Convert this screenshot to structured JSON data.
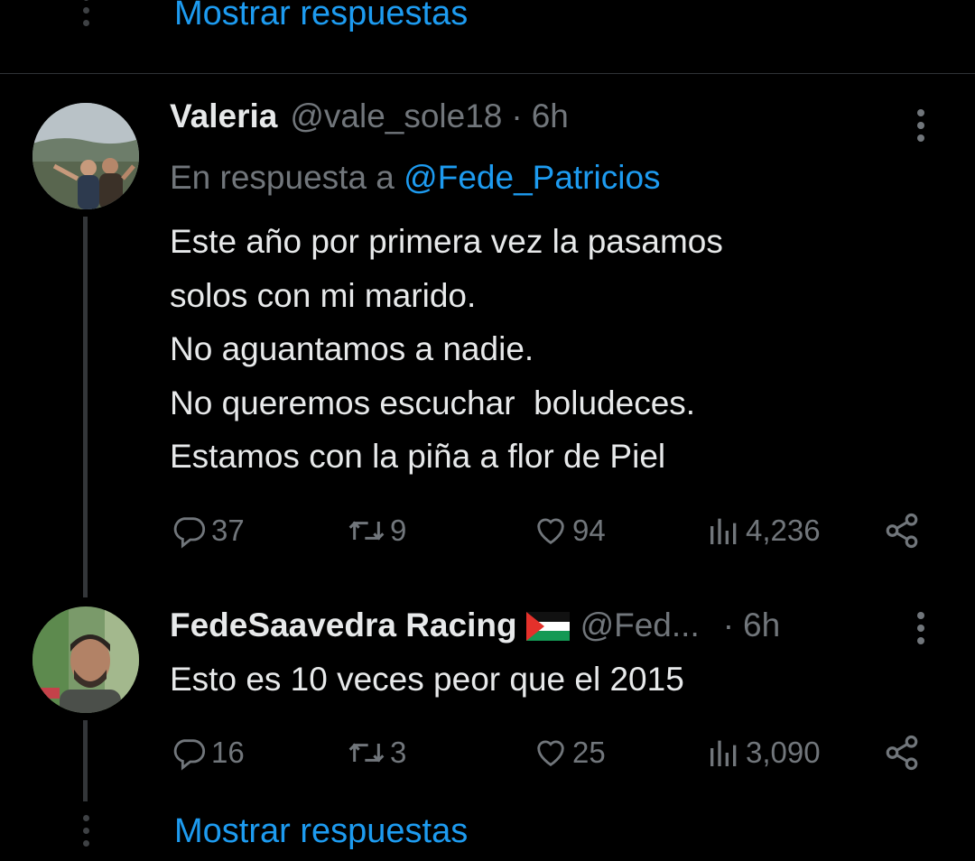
{
  "top": {
    "show_replies": "Mostrar respuestas"
  },
  "tweets": [
    {
      "display_name": "Valeria",
      "handle": "@vale_sole18",
      "sep": "·",
      "time": "6h",
      "reply_prefix": "En respuesta a",
      "reply_to": "@Fede_Patricios",
      "text": "Este año por primera vez la pasamos\nsolos con mi marido.\nNo aguantamos a nadie.\nNo queremos escuchar  boludeces.\nEstamos con la piña a flor de Piel",
      "replies": "37",
      "retweets": "9",
      "likes": "94",
      "views": "4,236"
    },
    {
      "display_name": "FedeSaavedra Racing",
      "handle": "@Fed...",
      "sep": "·",
      "time": "6h",
      "text": "Esto es 10 veces peor que el 2015",
      "replies": "16",
      "retweets": "3",
      "likes": "25",
      "views": "3,090",
      "flag": "palestine-flag-icon"
    }
  ],
  "bottom": {
    "show_replies": "Mostrar respuestas"
  },
  "colors": {
    "background": "#000000",
    "text": "#e7e9ea",
    "muted": "#71767b",
    "link": "#1d9bf0"
  }
}
